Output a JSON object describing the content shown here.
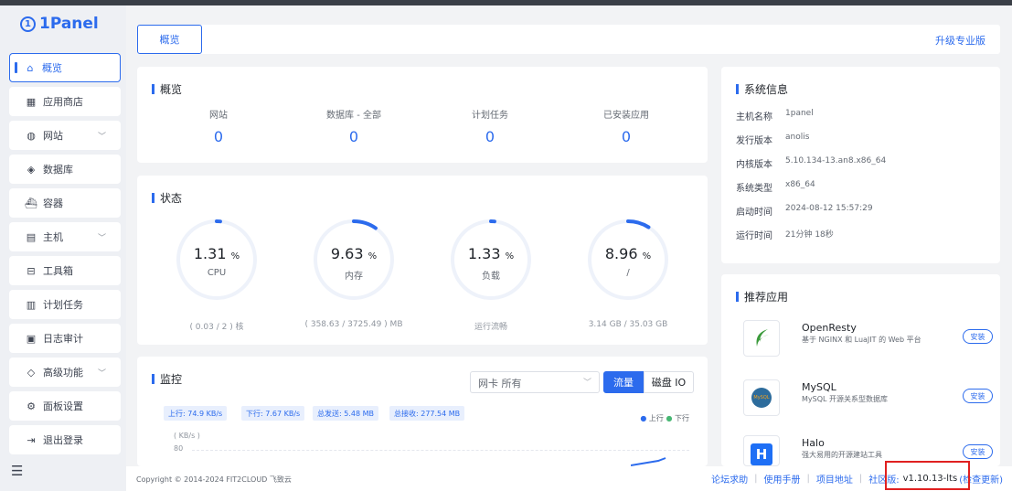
{
  "app": {
    "logo_text": "1Panel"
  },
  "sidebar": {
    "items": [
      {
        "label": "概览",
        "icon": "home-icon",
        "active": true,
        "caret": false
      },
      {
        "label": "应用商店",
        "icon": "grid-icon",
        "caret": false
      },
      {
        "label": "网站",
        "icon": "globe-icon",
        "caret": true
      },
      {
        "label": "数据库",
        "icon": "database-icon",
        "caret": false
      },
      {
        "label": "容器",
        "icon": "docker-icon",
        "caret": false
      },
      {
        "label": "主机",
        "icon": "host-icon",
        "caret": true
      },
      {
        "label": "工具箱",
        "icon": "toolbox-icon",
        "caret": false
      },
      {
        "label": "计划任务",
        "icon": "calendar-icon",
        "caret": false
      },
      {
        "label": "日志审计",
        "icon": "log-icon",
        "caret": false
      },
      {
        "label": "高级功能",
        "icon": "diamond-icon",
        "caret": true
      },
      {
        "label": "面板设置",
        "icon": "gear-icon",
        "caret": false
      },
      {
        "label": "退出登录",
        "icon": "logout-icon",
        "caret": false
      }
    ]
  },
  "header": {
    "tab": "概览",
    "upgrade": "升级专业版"
  },
  "overview": {
    "title": "概览",
    "stats": [
      {
        "label": "网站",
        "value": "0"
      },
      {
        "label": "数据库 - 全部",
        "value": "0"
      },
      {
        "label": "计划任务",
        "value": "0"
      },
      {
        "label": "已安装应用",
        "value": "0"
      }
    ]
  },
  "status": {
    "title": "状态",
    "gauges": [
      {
        "value": "1.31",
        "unit": "%",
        "label": "CPU",
        "sub": "( 0.03 / 2 ) 核",
        "pct": 1.31
      },
      {
        "value": "9.63",
        "unit": "%",
        "label": "内存",
        "sub": "( 358.63 / 3725.49 ) MB",
        "pct": 9.63
      },
      {
        "value": "1.33",
        "unit": "%",
        "label": "负载",
        "sub": "运行流畅",
        "pct": 1.33
      },
      {
        "value": "8.96",
        "unit": "%",
        "label": "/",
        "sub": "3.14 GB / 35.03 GB",
        "pct": 8.96
      }
    ]
  },
  "monitor": {
    "title": "监控",
    "nic_select": "网卡 所有",
    "btn_traffic": "流量",
    "btn_disk": "磁盘 IO",
    "pills": [
      "上行: 74.9 KB/s",
      "下行: 7.67 KB/s",
      "总发送: 5.48 MB",
      "总接收: 277.54 MB"
    ],
    "legend_up": "上行",
    "legend_down": "下行",
    "unit": "( KB/s )",
    "tick": "80"
  },
  "sysinfo": {
    "title": "系统信息",
    "rows": [
      {
        "k": "主机名称",
        "v": "1panel"
      },
      {
        "k": "发行版本",
        "v": "anolis"
      },
      {
        "k": "内核版本",
        "v": "5.10.134-13.an8.x86_64"
      },
      {
        "k": "系统类型",
        "v": "x86_64"
      },
      {
        "k": "启动时间",
        "v": "2024-08-12 15:57:29"
      },
      {
        "k": "运行时间",
        "v": "21分钟 18秒"
      }
    ]
  },
  "recommend": {
    "title": "推荐应用",
    "install_label": "安装",
    "apps": [
      {
        "name": "OpenResty",
        "desc": "基于 NGINX 和 LuaJIT 的 Web 平台",
        "icon": "openresty-icon"
      },
      {
        "name": "MySQL",
        "desc": "MySQL 开源关系型数据库",
        "icon": "mysql-icon",
        "logo_text": "MySQL"
      },
      {
        "name": "Halo",
        "desc": "强大易用的开源建站工具",
        "icon": "halo-icon",
        "logo_text": "H"
      }
    ]
  },
  "footer": {
    "copyright": "Copyright © 2014-2024 FIT2CLOUD 飞致云",
    "links": [
      "论坛求助",
      "使用手册",
      "项目地址",
      "社区版:"
    ],
    "version": "v1.10.13-lts",
    "check_update": "(检查更新)"
  },
  "colors": {
    "accent": "#2c6bed",
    "highlight": "#e02020"
  }
}
